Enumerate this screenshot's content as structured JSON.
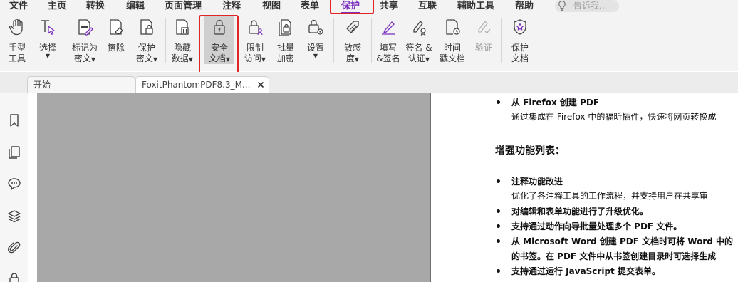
{
  "menu": {
    "file": "文件",
    "home": "主页",
    "convert": "转换",
    "edit": "编辑",
    "organize": "页面管理",
    "comment": "注释",
    "view": "视图",
    "form": "表单",
    "protect": "保护",
    "share": "共享",
    "connect": "互联",
    "accessibility": "辅助工具",
    "help": "帮助"
  },
  "search": {
    "placeholder": "告诉我..."
  },
  "ribbon": {
    "hand_l1": "手型",
    "hand_l2": "工具",
    "select_l1": "选择",
    "mark_redact_l1": "标记为",
    "mark_redact_l2": "密文",
    "erase_l1": "擦除",
    "protect_redact_l1": "保护",
    "protect_redact_l2": "密文",
    "hide_data_l1": "隐藏",
    "hide_data_l2": "数据",
    "secure_doc_l1": "安全",
    "secure_doc_l2": "文档",
    "restrict_l1": "限制",
    "restrict_l2": "访问",
    "batch_l1": "批量",
    "batch_l2": "加密",
    "settings_l1": "设置",
    "sensitivity_l1": "敏感",
    "sensitivity_l2": "度",
    "fill_sign_l1": "填写",
    "fill_sign_l2": "&签名",
    "sign_certify_l1": "签名 &",
    "sign_certify_l2": "认证",
    "timestamp_l1": "时间",
    "timestamp_l2": "戳文档",
    "validate_l1": "验证",
    "protect_doc_l1": "保护",
    "protect_doc_l2": "文档"
  },
  "tabs": {
    "start": "开始",
    "doc": "FoxitPhantomPDF8.3_M..."
  },
  "content": {
    "item1_title": "从 Firefox 创建 PDF",
    "item1_desc": "通过集成在 Firefox 中的福昕插件，快速将网页转换成",
    "heading": "增强功能列表：",
    "item2_title": "注释功能改进",
    "item2_desc": "优化了各注释工具的工作流程，并支持用户在共享审",
    "item3": "对编辑和表单功能进行了升级优化。",
    "item4": "支持通过动作向导批量处理多个 PDF 文件。",
    "item5_l1": "从 Microsoft Word 创建 PDF 文档时可将 Word 中的",
    "item5_l2": "的书签。在 PDF 文件中从书签创建目录时可选择生成",
    "item6": "支持通过运行 JavaScript 提交表单。"
  },
  "colors": {
    "accent": "#7a2fbf",
    "highlight": "#e02525",
    "page_gray": "#a8a8a8"
  }
}
